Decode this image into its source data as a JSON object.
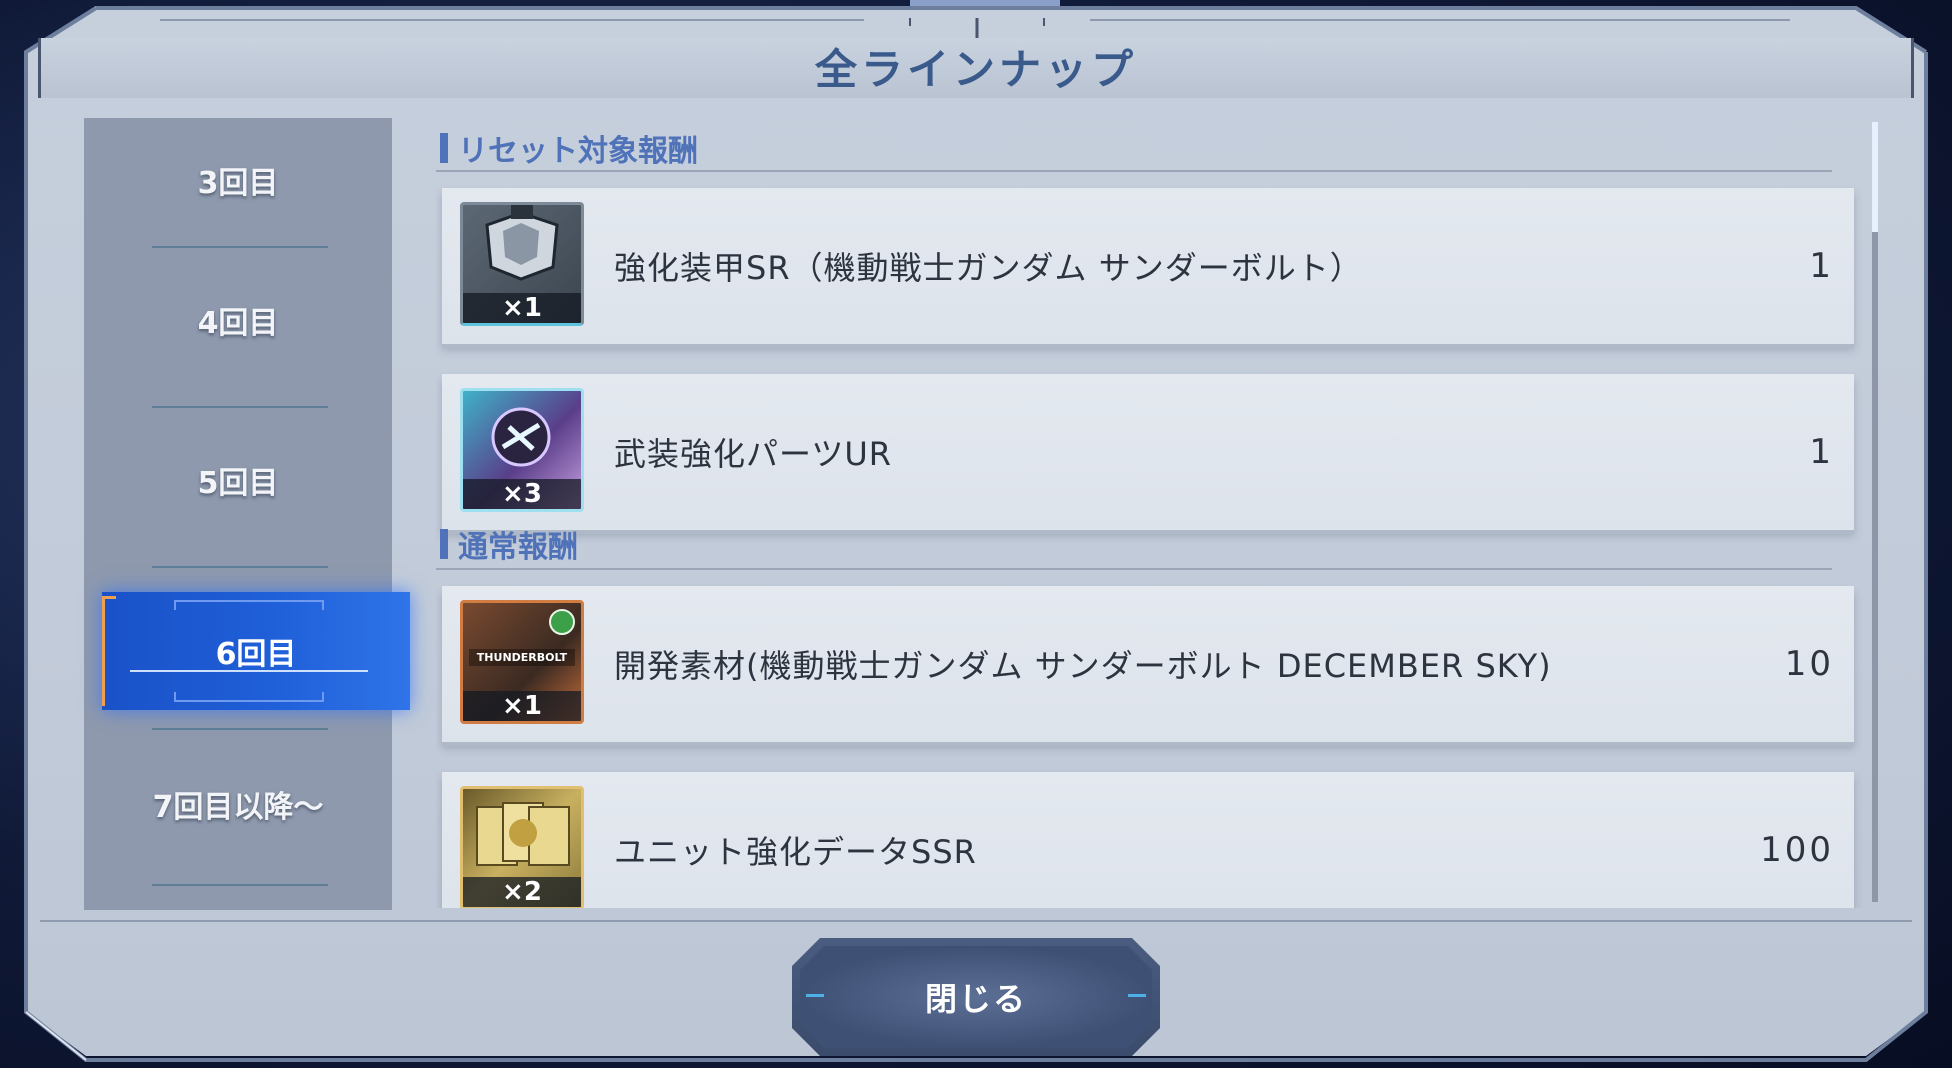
{
  "dialog": {
    "title": "全ラインナップ",
    "close_label": "閉じる"
  },
  "sidebar": {
    "items": [
      {
        "label": "3回目",
        "active": false
      },
      {
        "label": "4回目",
        "active": false
      },
      {
        "label": "5回目",
        "active": false
      },
      {
        "label": "6回目",
        "active": true
      },
      {
        "label": "7回目以降～",
        "active": false
      }
    ]
  },
  "sections": [
    {
      "title": "リセット対象報酬",
      "items": [
        {
          "name": "強化装甲SR（機動戦士ガンダム サンダーボルト）",
          "quantity": "1",
          "icon": "armor-icon",
          "icon_count": "×1"
        },
        {
          "name": "武装強化パーツUR",
          "quantity": "1",
          "icon": "weapon-parts-icon",
          "icon_count": "×3"
        }
      ]
    },
    {
      "title": "通常報酬",
      "items": [
        {
          "name": "開発素材(機動戦士ガンダム サンダーボルト DECEMBER SKY)",
          "quantity": "10",
          "icon": "development-material-icon",
          "icon_count": "×1",
          "icon_text": "THUNDERBOLT"
        },
        {
          "name": "ユニット強化データSSR",
          "quantity": "100",
          "icon": "unit-data-icon",
          "icon_count": "×2"
        }
      ]
    }
  ],
  "colors": {
    "accent_blue": "#1f5fd8",
    "section_title": "#4f72b8",
    "panel_bg": "#c2cbd9"
  }
}
